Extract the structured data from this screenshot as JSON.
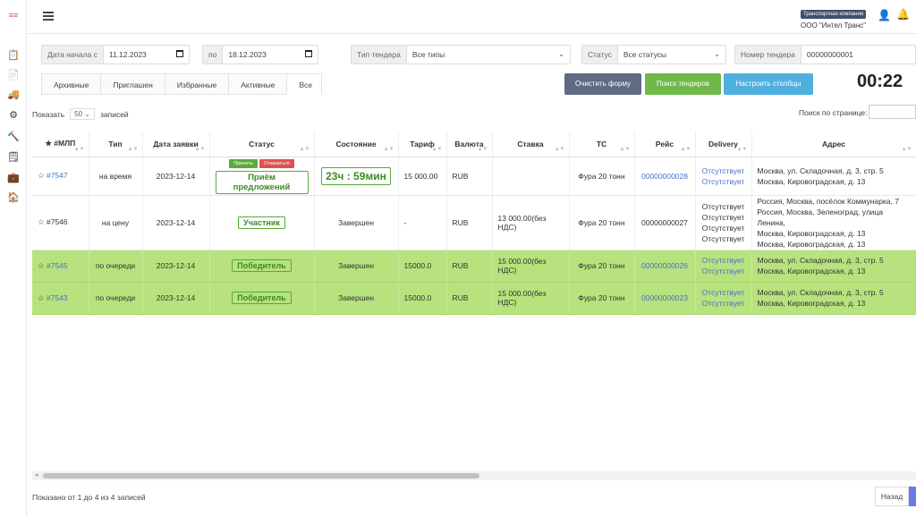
{
  "sidebar": {
    "logo": "≡≡",
    "icons": [
      "clipboard-icon",
      "document-icon",
      "truck-icon",
      "cogs-icon",
      "hammer-icon",
      "file-icon",
      "briefcase-icon",
      "home-icon"
    ],
    "glyphs": [
      "📋",
      "📄",
      "🚚",
      "⚙",
      "🔨",
      "🗒",
      "💼",
      "🏠"
    ]
  },
  "header": {
    "company_badge": "Транспортная компания",
    "company_name": "ООО \"Интел Транс\"",
    "user_glyph": "👤",
    "bell_glyph": "🔔"
  },
  "filters": {
    "date_from_label": "Дата начала с",
    "date_from_value": "11.12.2023",
    "date_to_label": "по",
    "date_to_value": "18.12.2023",
    "tender_type_label": "Тип тендера",
    "tender_type_value": "Все типы",
    "status_label": "Статус",
    "status_value": "Все статусы",
    "tender_number_label": "Номер тендера",
    "tender_number_value": "00000000001"
  },
  "tabs": [
    "Архивные",
    "Приглашен",
    "Избранные",
    "Активные",
    "Все"
  ],
  "active_tab": "Все",
  "buttons": {
    "clear": "Очистить форму",
    "search": "Поиск тендеров",
    "columns": "Настроить столбцы"
  },
  "timer": "00:22",
  "table_controls": {
    "show_label": "Показать",
    "show_value": "50",
    "records_label": "записей",
    "page_search_label": "Поиск по странице:"
  },
  "columns": [
    "★ #МЛП",
    "Тип",
    "Дата заявки",
    "Статус",
    "Состояние",
    "Тариф",
    "Валюта",
    "Ставка",
    "ТС",
    "Рейс",
    "Delivery",
    "Адрес"
  ],
  "rows": [
    {
      "id": "#7547",
      "type": "на время",
      "date": "2023-12-14",
      "accept": "Принять",
      "reject": "Отказаться",
      "status": "Приём предложений",
      "state": "23ч : 59мин",
      "tariff": "15 000.00",
      "currency": "RUB",
      "rate": "",
      "vehicle": "Фура 20 тонн",
      "trip": "00000000028",
      "delivery": [
        "Отсутствует",
        "Отсутствует"
      ],
      "address": [
        "Москва, ул. Складочная, д. 3, стр. 5",
        "Москва, Кировоградская, д. 13"
      ]
    },
    {
      "id": "#7546",
      "type": "на цену",
      "date": "2023-12-14",
      "status": "Участник",
      "state": "Завершен",
      "tariff": "-",
      "currency": "RUB",
      "rate": "13 000.00(без НДС)",
      "vehicle": "Фура 20 тонн",
      "trip": "00000000027",
      "delivery": [
        "Отсутствует",
        "Отсутствует",
        "Отсутствует",
        "Отсутствует"
      ],
      "address": [
        "Россия, Москва, посёлок Коммунарка, 7",
        "Россия, Москва, Зеленоград, улица Ленина,",
        "Москва, Кировоградская, д. 13",
        "Москва, Кировоградская, д. 13"
      ]
    },
    {
      "id": "#7545",
      "type": "по очереди",
      "date": "2023-12-14",
      "status": "Победитель",
      "state": "Завершен",
      "tariff": "15000.0",
      "currency": "RUB",
      "rate": "15 000.00(без НДС)",
      "vehicle": "Фура 20 тонн",
      "trip": "00000000026",
      "delivery": [
        "Отсутствует",
        "Отсутствует"
      ],
      "address": [
        "Москва, ул. Складочная, д. 3, стр. 5",
        "Москва, Кировоградская, д. 13"
      ]
    },
    {
      "id": "#7543",
      "type": "по очереди",
      "date": "2023-12-14",
      "status": "Победитель",
      "state": "Завершен",
      "tariff": "15000.0",
      "currency": "RUB",
      "rate": "15 000.00(без НДС)",
      "vehicle": "Фура 20 тонн",
      "trip": "00000000023",
      "delivery": [
        "Отсутствует",
        "Отсутствует"
      ],
      "address": [
        "Москва, ул. Складочная, д. 3, стр. 5",
        "Москва, Кировоградская, д. 13"
      ]
    }
  ],
  "footer": {
    "info": "Показано от 1 до 4 из 4 записей",
    "back": "Назад"
  },
  "colors": {
    "winner_row": "#b7e27d",
    "link": "#4a6fd0",
    "btn_clear": "#5f6b82",
    "btn_search": "#6fb84a",
    "btn_columns": "#4fb0e0"
  }
}
